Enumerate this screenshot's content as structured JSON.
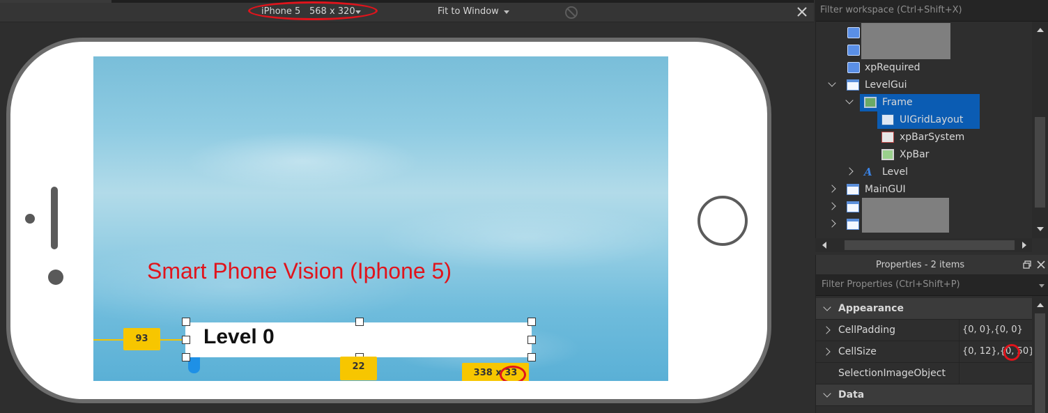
{
  "emulator": {
    "device_label": "iPhone 5",
    "resolution_label": "568 x 320",
    "fit_label": "Fit to Window"
  },
  "screen": {
    "annotation": "Smart Phone Vision (Iphone 5)",
    "level_text": "Level 0",
    "offset_tag": "93",
    "gap_tag": "22",
    "size_tag_width": "338 x",
    "size_tag_height": "33"
  },
  "explorer": {
    "filter_placeholder": "Filter workspace (Ctrl+Shift+X)",
    "items": [
      {
        "label": "xpRequired",
        "icon": "script-icon"
      },
      {
        "label": "LevelGui",
        "icon": "screen-gui-icon",
        "expanded": true
      },
      {
        "label": "Frame",
        "icon": "frame-icon",
        "expanded": true,
        "selected": true
      },
      {
        "label": "UIGridLayout",
        "icon": "grid-layout-icon",
        "selected": true
      },
      {
        "label": "xpBarSystem",
        "icon": "local-script-icon"
      },
      {
        "label": "XpBar",
        "icon": "image-label-icon"
      },
      {
        "label": "Level",
        "icon": "text-label-icon",
        "expanded": false
      },
      {
        "label": "MainGUI",
        "icon": "screen-gui-icon",
        "expanded": false
      }
    ]
  },
  "properties": {
    "title": "Properties - 2 items",
    "filter_placeholder": "Filter Properties (Ctrl+Shift+P)",
    "categories": [
      {
        "name": "Appearance",
        "expanded": true
      },
      {
        "name": "Data",
        "expanded": true
      }
    ],
    "rows": [
      {
        "name": "CellPadding",
        "value": "{0, 0},{0, 0}"
      },
      {
        "name": "CellSize",
        "value": "{0, 12},{0, 50}"
      },
      {
        "name": "SelectionImageObject",
        "value": ""
      }
    ]
  },
  "colors": {
    "selection": "#0b5cb3",
    "annotation_red": "#e0141c",
    "guide_yellow": "#f7c600",
    "level_accent": "#1e90e6"
  }
}
